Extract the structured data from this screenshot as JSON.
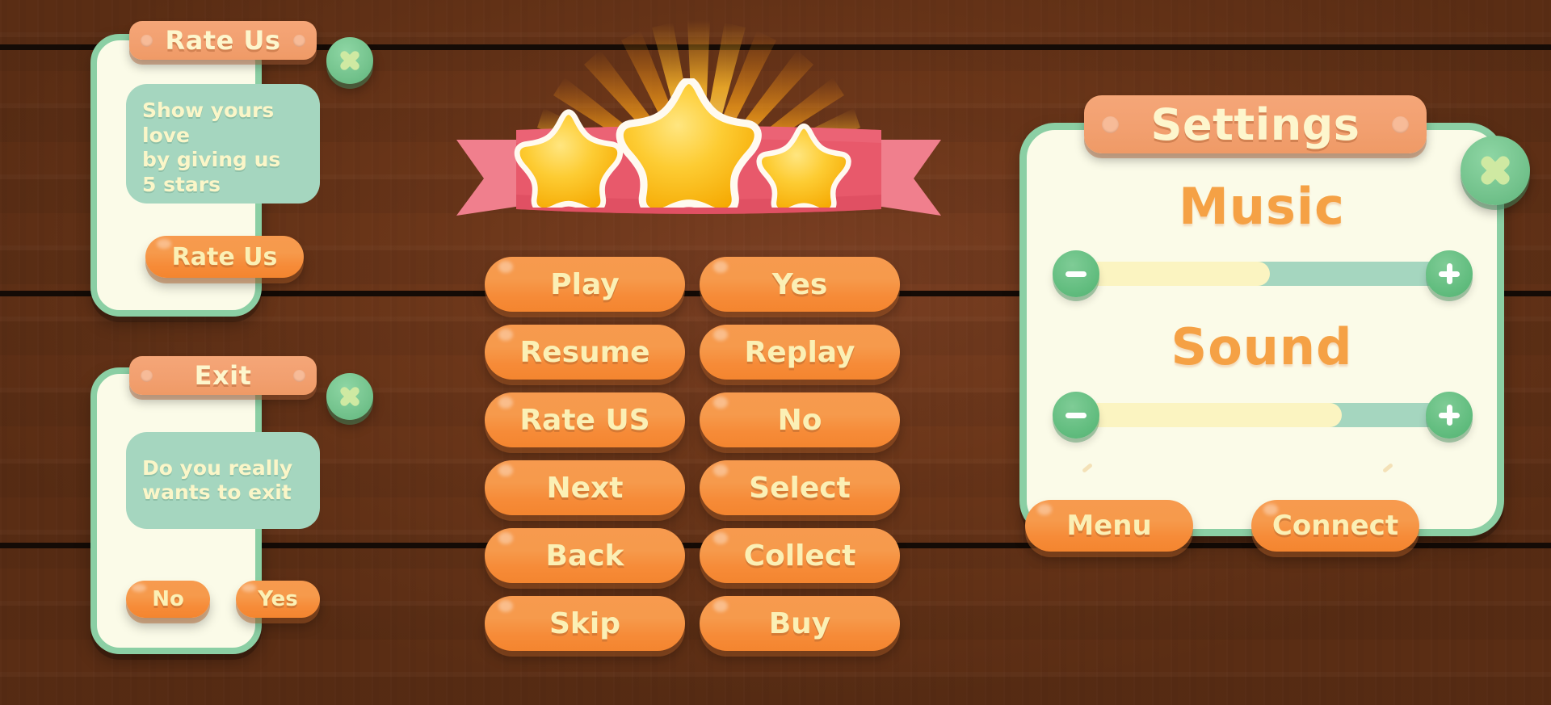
{
  "theme": {
    "wood_dark": "#5a2d14",
    "wood_mid": "#7a3f23",
    "panel_cream": "#fbfbe8",
    "panel_border_green": "#8bcfa4",
    "plate_orange": "#f2a070",
    "button_orange": "#f68b38",
    "button_text_cream": "#fbf0b5",
    "message_green": "#a5d6bf",
    "label_orange": "#f5a145",
    "slider_fill": "#fbf4c1",
    "ribbon_pink": "#e8596b",
    "star_yellow": "#fdc41f"
  },
  "rate_us_dialog": {
    "title": "Rate Us",
    "message": "Show yours love\nby giving us\n5 stars",
    "message_lines": [
      "Show yours love",
      "by giving us",
      "5 stars"
    ],
    "action_button": "Rate Us",
    "close_icon": "close-x-icon"
  },
  "exit_dialog": {
    "title": "Exit",
    "message_lines": [
      "Do you really",
      "wants to exit"
    ],
    "buttons": [
      "No",
      "Yes"
    ],
    "close_icon": "close-x-icon"
  },
  "star_banner": {
    "stars_filled": 3,
    "stars_total": 3,
    "ribbon_color": "#e8596b",
    "burst_icon": "sunburst-rays"
  },
  "button_grid": {
    "rows": [
      {
        "left": "Play",
        "right": "Yes"
      },
      {
        "left": "Resume",
        "right": "Replay"
      },
      {
        "left": "Rate US",
        "right": "No"
      },
      {
        "left": "Next",
        "right": "Select"
      },
      {
        "left": "Back",
        "right": "Collect"
      },
      {
        "left": "Skip",
        "right": "Buy"
      }
    ]
  },
  "settings_panel": {
    "title": "Settings",
    "close_icon": "close-x-icon",
    "music": {
      "label": "Music",
      "value_percent": 52,
      "minus_icon": "minus-icon",
      "plus_icon": "plus-icon"
    },
    "sound": {
      "label": "Sound",
      "value_percent": 72,
      "minus_icon": "minus-icon",
      "plus_icon": "plus-icon"
    },
    "footer_buttons": [
      "Menu",
      "Connect"
    ]
  }
}
